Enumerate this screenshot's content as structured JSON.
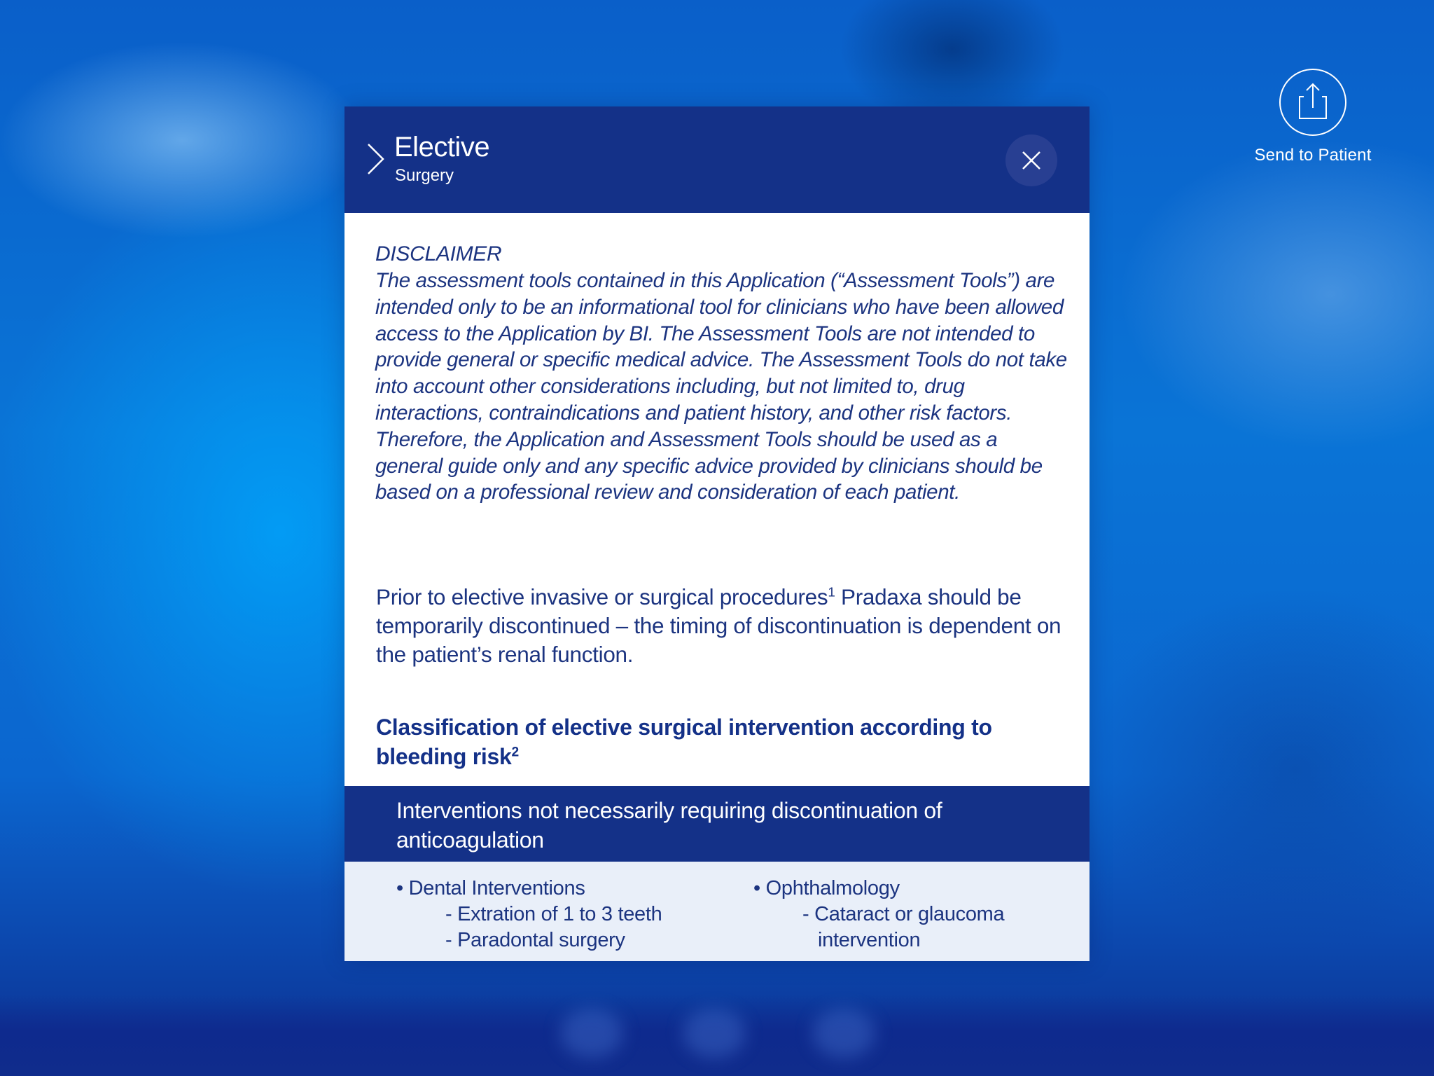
{
  "send": {
    "label": "Send to Patient",
    "icon": "share-icon"
  },
  "modal": {
    "title": "Elective",
    "subtitle": "Surgery",
    "close_icon": "close-icon",
    "chevron_icon": "chevron-right-icon",
    "disclaimer_title": "DISCLAIMER",
    "disclaimer_body": "The assessment tools contained in this Application (“Assessment Tools”) are intended only to be an informational tool for clinicians who have been allowed access to the Application by BI. The Assessment Tools are not intended to provide general or specific medical advice. The Assessment Tools do not take into account other considerations including, but not limited to, drug interactions, contraindications and patient history, and other risk factors. Therefore, the Application and Assessment Tools should be used as a general guide only and any specific advice provided by clinicians should be based on a professional review and consideration of each patient.",
    "intro_before": "Prior to elective invasive or surgical procedures",
    "intro_ref": "1",
    "intro_after": " Pradaxa should be temporarily discontinued – the timing of discontinuation is dependent on the patient’s renal function.",
    "heading": "Classification of elective surgical intervention according to bleeding risk",
    "heading_ref": "2",
    "table": {
      "header": "Interventions not necessarily requiring discontinuation of anticoagulation",
      "col1": {
        "bullet": "• Dental Interventions",
        "items": [
          "- Extration of 1 to 3 teeth",
          "- Paradontal surgery"
        ]
      },
      "col2": {
        "bullet": "• Ophthalmology",
        "items": [
          "- Cataract or glaucoma",
          "intervention"
        ]
      }
    }
  },
  "colors": {
    "navy": "#143188",
    "text_blue": "#1c3480",
    "table_body": "#e9eff9",
    "background_blue": "#0a74d6"
  }
}
